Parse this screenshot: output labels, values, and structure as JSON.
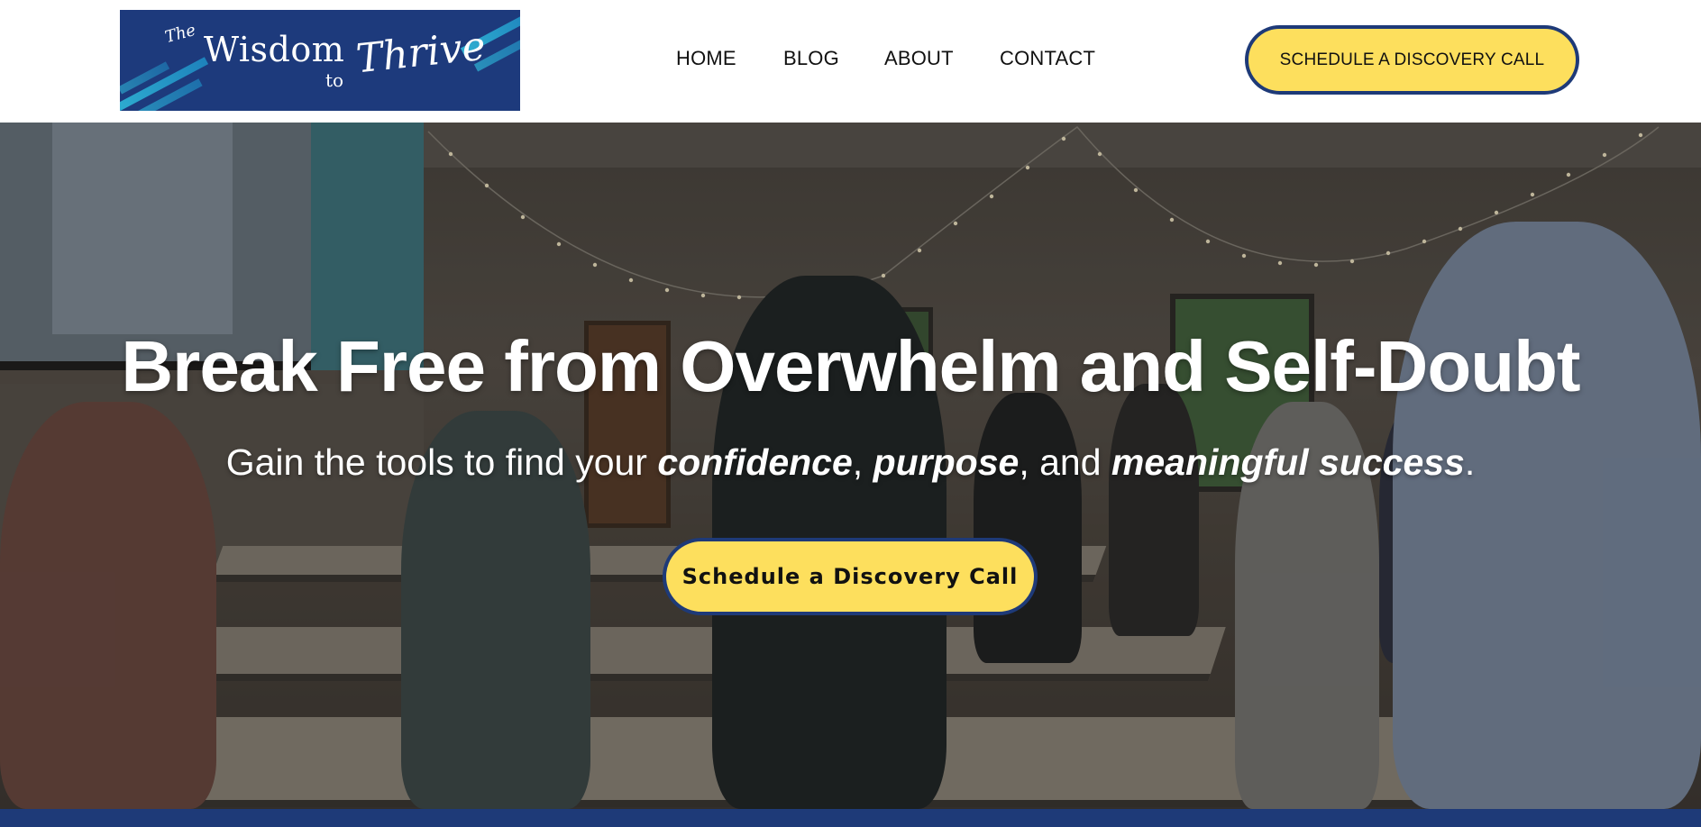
{
  "header": {
    "logo": {
      "the": "The",
      "wisdom": "Wisdom",
      "to": "to",
      "thrive": "Thrive"
    },
    "nav": [
      {
        "label": "HOME"
      },
      {
        "label": "BLOG"
      },
      {
        "label": "ABOUT"
      },
      {
        "label": "CONTACT"
      }
    ],
    "cta_label": "SCHEDULE A DISCOVERY CALL"
  },
  "hero": {
    "title": "Break Free from Overwhelm and Self-Doubt",
    "subtitle": {
      "part1": "Gain the tools to find your ",
      "em1": "confidence",
      "sep1": ", ",
      "em2": "purpose",
      "sep2": ", and ",
      "em3": "meaningful success",
      "end": "."
    },
    "cta_label": "Schedule a Discovery Call"
  },
  "colors": {
    "brand_navy": "#1e3a78",
    "cta_yellow": "#fddf5d",
    "logo_accent": "#2fb5d6"
  },
  "icons": {
    "background": "hero-photo-workshop-room"
  }
}
